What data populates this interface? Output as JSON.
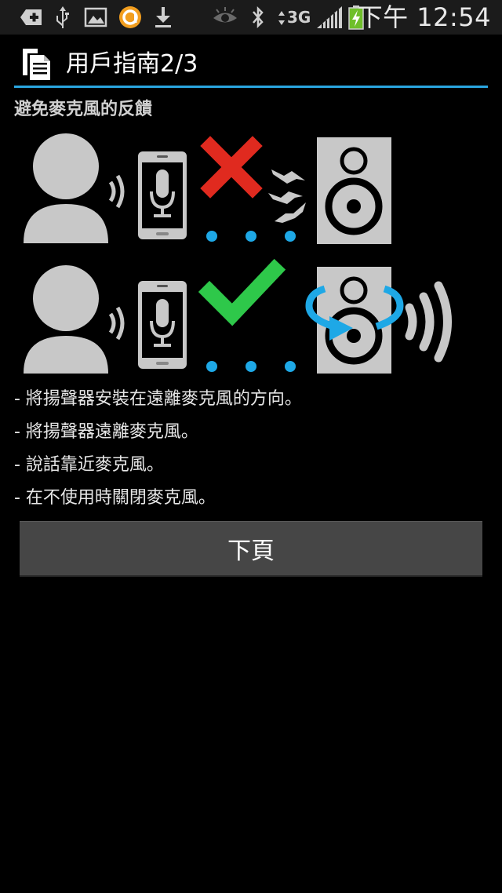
{
  "status_bar": {
    "network": "3G",
    "time": "下午 12:54"
  },
  "dialog": {
    "title": "用戶指南2/3",
    "subheading": "避免麥克風的反饋"
  },
  "tips": [
    "- 將揚聲器安裝在遠離麥克風的方向。",
    "- 將揚聲器遠離麥克風。",
    "- 說話靠近麥克風。",
    "- 在不使用時關閉麥克風。"
  ],
  "next_button": {
    "label": "下頁"
  },
  "colors": {
    "accent": "#2aa6e0",
    "icon_gray": "#c8c8c8",
    "wrong": "#e02a1f",
    "right": "#2ec84a",
    "dot": "#1ea8e6"
  }
}
